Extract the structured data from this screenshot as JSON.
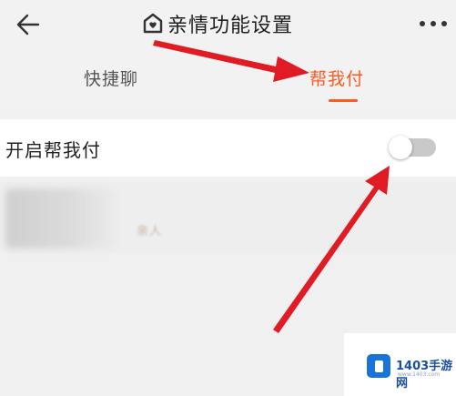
{
  "header": {
    "title": "亲情功能设置",
    "back_icon": "arrow-left-icon",
    "title_icon": "house-heart-icon",
    "more_icon": "more-dots-icon"
  },
  "tabs": [
    {
      "label": "快捷聊",
      "active": false
    },
    {
      "label": "帮我付",
      "active": true
    }
  ],
  "setting": {
    "label": "开启帮我付",
    "toggle_on": false
  },
  "contact": {
    "role": "亲人"
  },
  "watermark": {
    "brand": "1403手游网",
    "url": "www.1403.com"
  },
  "colors": {
    "accent": "#ff5a1f",
    "annotation_arrow": "#e01b24",
    "background": "#f0f0f0"
  }
}
